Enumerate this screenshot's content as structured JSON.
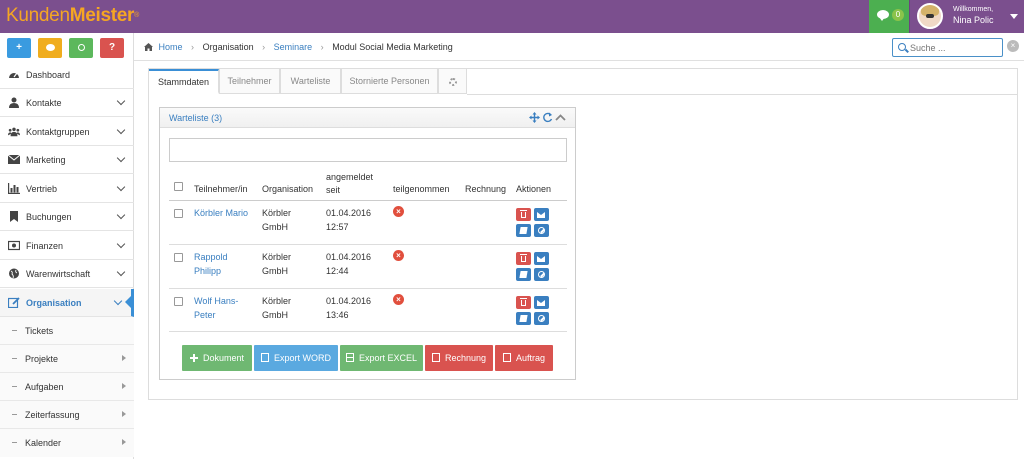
{
  "brand": {
    "part1": "Kunden",
    "part2": "Meister",
    "reg": "®"
  },
  "colors": {
    "topbar": "#7b4f8e",
    "accent": "#3a8fd6",
    "brand_orange": "#f5a623",
    "green": "#4caf50",
    "red": "#d9534f"
  },
  "header": {
    "chat_badge": "0",
    "welcome": "Willkommen,",
    "user_name": "Nina Polic"
  },
  "quick_buttons": [
    {
      "icon": "plus-icon",
      "label": "+",
      "color": "#3a9be0"
    },
    {
      "icon": "chat-icon",
      "label": "",
      "color": "#f0ad1e"
    },
    {
      "icon": "search-icon",
      "label": "",
      "color": "#5cb85c"
    },
    {
      "icon": "help-icon",
      "label": "?",
      "color": "#d9534f"
    }
  ],
  "sidebar": {
    "items": [
      {
        "label": "Dashboard",
        "icon": "dashboard-icon"
      },
      {
        "label": "Kontakte",
        "icon": "user-icon"
      },
      {
        "label": "Kontaktgruppen",
        "icon": "group-icon"
      },
      {
        "label": "Marketing",
        "icon": "envelope-icon"
      },
      {
        "label": "Vertrieb",
        "icon": "bar-chart-icon"
      },
      {
        "label": "Buchungen",
        "icon": "bookmark-icon"
      },
      {
        "label": "Finanzen",
        "icon": "money-icon"
      },
      {
        "label": "Warenwirtschaft",
        "icon": "globe-icon"
      },
      {
        "label": "Organisation",
        "icon": "edit-icon"
      }
    ],
    "sub_items": [
      {
        "label": "Tickets"
      },
      {
        "label": "Projekte"
      },
      {
        "label": "Aufgaben"
      },
      {
        "label": "Zeiterfassung"
      },
      {
        "label": "Kalender"
      }
    ]
  },
  "breadcrumb": {
    "home": "Home",
    "organisation": "Organisation",
    "seminare": "Seminare",
    "current": "Modul Social Media Marketing"
  },
  "search": {
    "placeholder": "Suche ...",
    "clear": "×"
  },
  "tabs": [
    {
      "label": "Stammdaten"
    },
    {
      "label": "Teilnehmer"
    },
    {
      "label": "Warteliste"
    },
    {
      "label": "Stornierte Personen"
    }
  ],
  "panel": {
    "title": "Warteliste (3)",
    "columns": {
      "name": "Teilnehmer/in",
      "org": "Organisation",
      "date_l1": "angemeldet",
      "date_l2": "seit",
      "participated": "teilgenommen",
      "invoice": "Rechnung",
      "actions": "Aktionen"
    },
    "rows": [
      {
        "name_l1": "Körbler Mario",
        "name_l2": "",
        "org_l1": "Körbler",
        "org_l2": "GmbH",
        "date": "01.04.2016",
        "time": "12:57"
      },
      {
        "name_l1": "Rappold",
        "name_l2": "Philipp",
        "org_l1": "Körbler",
        "org_l2": "GmbH",
        "date": "01.04.2016",
        "time": "12:44"
      },
      {
        "name_l1": "Wolf Hans-",
        "name_l2": "Peter",
        "org_l1": "Körbler",
        "org_l2": "GmbH",
        "date": "01.04.2016",
        "time": "13:46"
      }
    ],
    "buttons": {
      "dokument": "Dokument",
      "word": "Export WORD",
      "excel": "Export EXCEL",
      "rechnung": "Rechnung",
      "auftrag": "Auftrag"
    }
  }
}
